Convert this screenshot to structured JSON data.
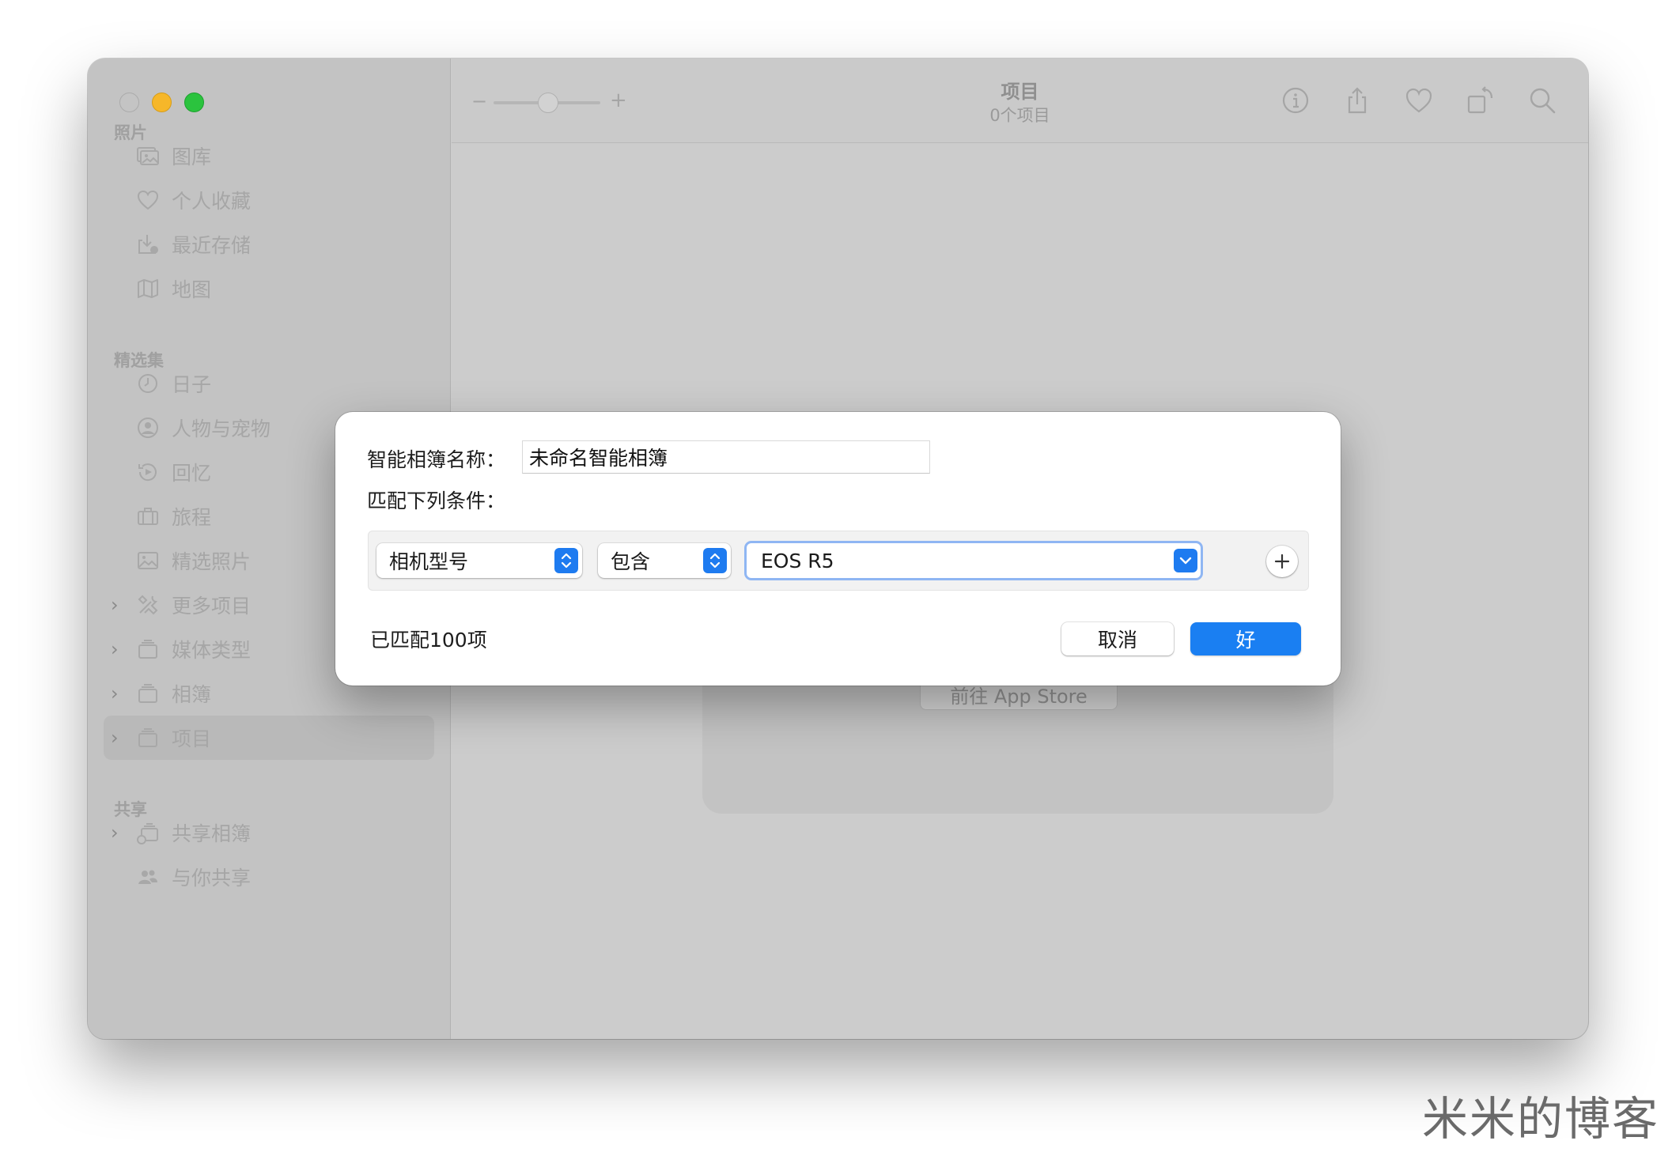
{
  "window": {
    "toolbar": {
      "title": "项目",
      "subtitle": "0个项目",
      "zoom_minus": "−",
      "zoom_plus": "+",
      "icons": [
        "info-icon",
        "share-icon",
        "heart-icon",
        "rotate-icon",
        "search-icon"
      ]
    },
    "sidebar": {
      "sections": [
        {
          "title": "照片",
          "items": [
            {
              "label": "图库",
              "icon": "photo-library-icon"
            },
            {
              "label": "个人收藏",
              "icon": "heart-icon"
            },
            {
              "label": "最近存储",
              "icon": "recent-import-icon"
            },
            {
              "label": "地图",
              "icon": "map-icon"
            }
          ]
        },
        {
          "title": "精选集",
          "items": [
            {
              "label": "日子",
              "icon": "clock-icon"
            },
            {
              "label": "人物与宠物",
              "icon": "person-circle-icon"
            },
            {
              "label": "回忆",
              "icon": "memories-icon"
            },
            {
              "label": "旅程",
              "icon": "suitcase-icon"
            },
            {
              "label": "精选照片",
              "icon": "featured-photo-icon"
            },
            {
              "label": "更多项目",
              "icon": "tools-icon",
              "expandable": true
            },
            {
              "label": "媒体类型",
              "icon": "stack-icon",
              "expandable": true
            },
            {
              "label": "相簿",
              "icon": "stack-icon",
              "expandable": true
            },
            {
              "label": "项目",
              "icon": "stack-icon",
              "expandable": true,
              "selected": true
            }
          ]
        },
        {
          "title": "共享",
          "items": [
            {
              "label": "共享相簿",
              "icon": "shared-album-icon",
              "expandable": true
            },
            {
              "label": "与你共享",
              "icon": "shared-with-you-icon"
            }
          ]
        }
      ]
    },
    "background": {
      "app_store_button": "前往 App Store"
    }
  },
  "dialog": {
    "name_label": "智能相簿名称：",
    "name_value": "未命名智能相簿",
    "match_label": "匹配下列条件：",
    "criteria": {
      "field": "相机型号",
      "operator": "包含",
      "value": "EOS R5"
    },
    "match_count": "已匹配100项",
    "cancel_label": "取消",
    "ok_label": "好",
    "accent_color": "#1A7FF2"
  },
  "watermark": "米米的博客"
}
